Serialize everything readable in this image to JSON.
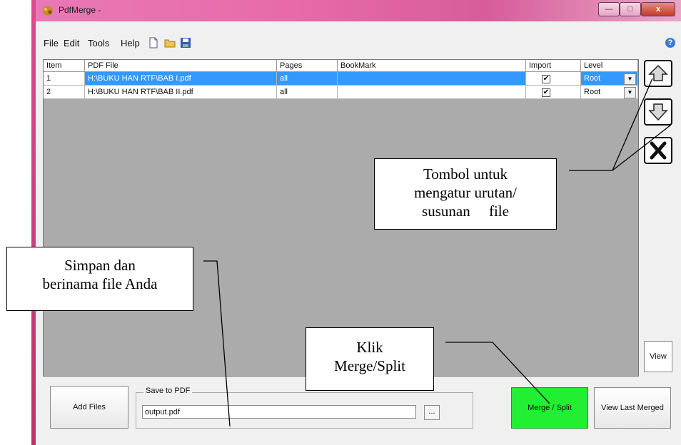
{
  "window": {
    "title": "PdfMerge -"
  },
  "menu": [
    "File",
    "Edit",
    "Tools",
    "Help"
  ],
  "toolbar_icons": [
    "new-file-icon",
    "open-folder-icon",
    "save-disk-icon"
  ],
  "grid": {
    "columns": [
      "Item",
      "PDF File",
      "Pages",
      "BookMark",
      "Import",
      "Level"
    ],
    "rows": [
      {
        "item": "1",
        "file": "H:\\BUKU HAN RTF\\BAB I.pdf",
        "pages": "all",
        "bookmark": "",
        "import": true,
        "level": "Root",
        "selected": true
      },
      {
        "item": "2",
        "file": "H:\\BUKU HAN RTF\\BAB II.pdf",
        "pages": "all",
        "bookmark": "",
        "import": true,
        "level": "Root",
        "selected": false
      }
    ]
  },
  "side_buttons": [
    "move-up-icon",
    "move-down-icon",
    "remove-icon"
  ],
  "buttons": {
    "view": "View",
    "add_files": "Add Files",
    "merge_split": "Merge / Split",
    "view_last_merged": "View Last Merged",
    "browse": "..."
  },
  "save_to_pdf": {
    "label": "Save to PDF",
    "value": "output.pdf"
  },
  "callouts": {
    "order": [
      "Tombol untuk",
      "mengatur urutan/",
      "susunan     file"
    ],
    "save": [
      "Simpan dan",
      "berinama file Anda"
    ],
    "merge": [
      "Klik",
      "Merge/Split"
    ]
  },
  "colors": {
    "title_bar": "#e879b6",
    "selection": "#3399ff",
    "merge_button": "#22ee33",
    "grid_background": "#ababab"
  }
}
